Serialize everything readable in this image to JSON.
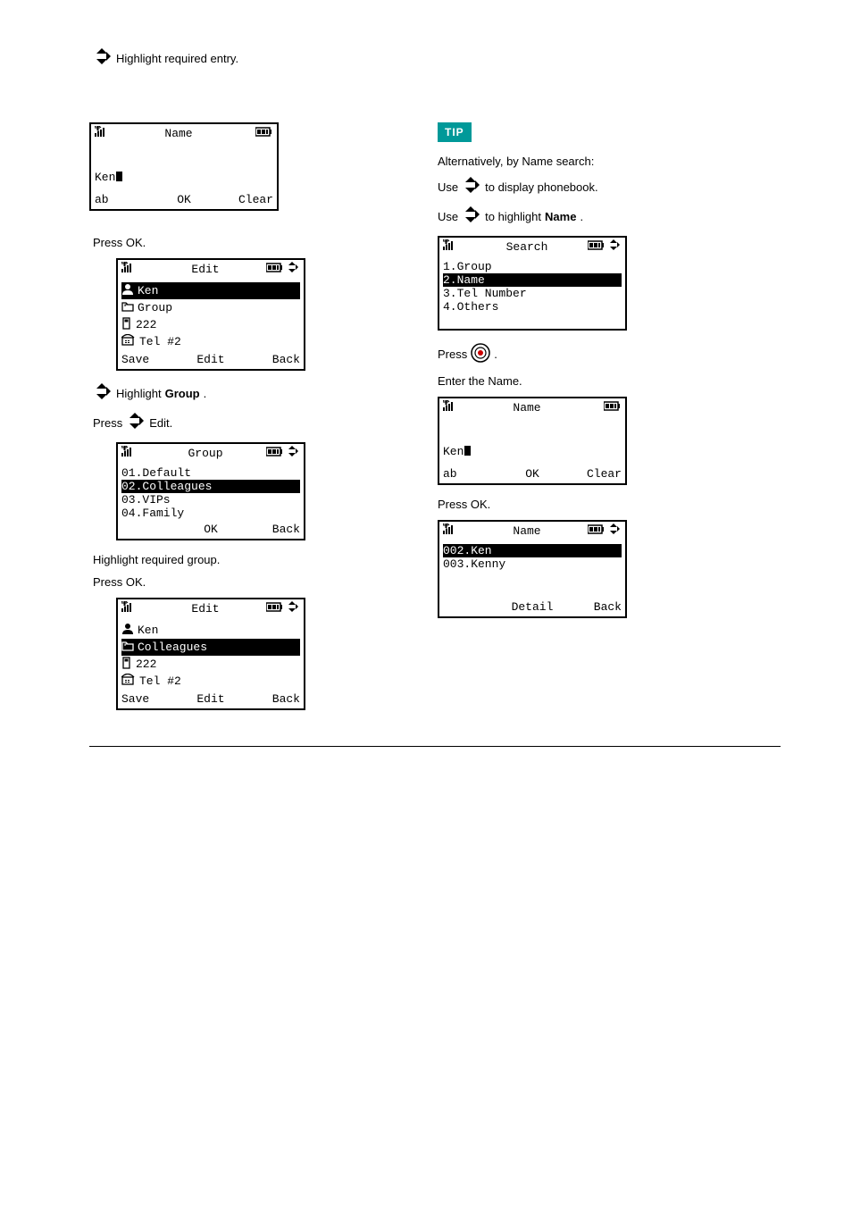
{
  "top_hint": "Highlight required entry.",
  "tip_label": "TIP",
  "left": {
    "screen1": {
      "title": "Name",
      "input": "Ken",
      "soft": [
        "ab",
        "OK",
        "Clear"
      ]
    },
    "hint_after_s1": "Press OK.",
    "screen2": {
      "title": "Edit",
      "rows": [
        {
          "icon": "person",
          "text": "Ken",
          "sel": true
        },
        {
          "icon": "folder",
          "text": "Group",
          "sel": false
        },
        {
          "icon": "mobile",
          "text": "222",
          "sel": false
        },
        {
          "icon": "phone2",
          "text": "Tel #2",
          "sel": false
        }
      ],
      "soft": [
        "Save",
        "Edit",
        "Back"
      ]
    },
    "hint_pair": [
      "Highlight",
      "Group",
      "."
    ],
    "hint_pair2_prefix": "Press",
    "hint_pair2_suffix": "Edit.",
    "screen3": {
      "title": "Group",
      "rows": [
        {
          "text": "01.Default",
          "sel": false
        },
        {
          "text": "02.Colleagues",
          "sel": true
        },
        {
          "text": "03.VIPs",
          "sel": false
        },
        {
          "text": "04.Family",
          "sel": false
        }
      ],
      "soft": [
        "",
        "OK",
        "Back"
      ]
    },
    "hint_after_s3a": "Highlight required group.",
    "hint_after_s3b": "Press OK.",
    "screen4": {
      "title": "Edit",
      "rows": [
        {
          "icon": "person",
          "text": "Ken",
          "sel": false
        },
        {
          "icon": "folder",
          "text": "Colleagues",
          "sel": true
        },
        {
          "icon": "mobile",
          "text": "222",
          "sel": false
        },
        {
          "icon": "phone2",
          "text": "Tel #2",
          "sel": false
        }
      ],
      "soft": [
        "Save",
        "Edit",
        "Back"
      ]
    }
  },
  "right": {
    "tip_line1": "Alternatively, by Name search:",
    "tip_line2_a": "Use",
    "tip_line2_b": "to display phonebook.",
    "tip_line3_a": "Use",
    "tip_line3_b": "to highlight",
    "tip_line3_c": "Name",
    "tip_line3_d": ".",
    "screenA": {
      "title": "Search",
      "rows": [
        {
          "text": "1.Group",
          "sel": false
        },
        {
          "text": "2.Name",
          "sel": true
        },
        {
          "text": "3.Tel Number",
          "sel": false
        },
        {
          "text": "4.Others",
          "sel": false
        }
      ],
      "soft": [
        "",
        "",
        ""
      ]
    },
    "hintA": "Press",
    "hintA2": ".",
    "hintB": "Enter the Name.",
    "screenB": {
      "title": "Name",
      "input": "Ken",
      "soft": [
        "ab",
        "OK",
        "Clear"
      ]
    },
    "hintC": "Press OK.",
    "screenC": {
      "title": "Name",
      "rows": [
        {
          "text": "002.Ken",
          "sel": true
        },
        {
          "text": "003.Kenny",
          "sel": false
        }
      ],
      "soft": [
        "",
        "Detail",
        "Back"
      ]
    }
  }
}
